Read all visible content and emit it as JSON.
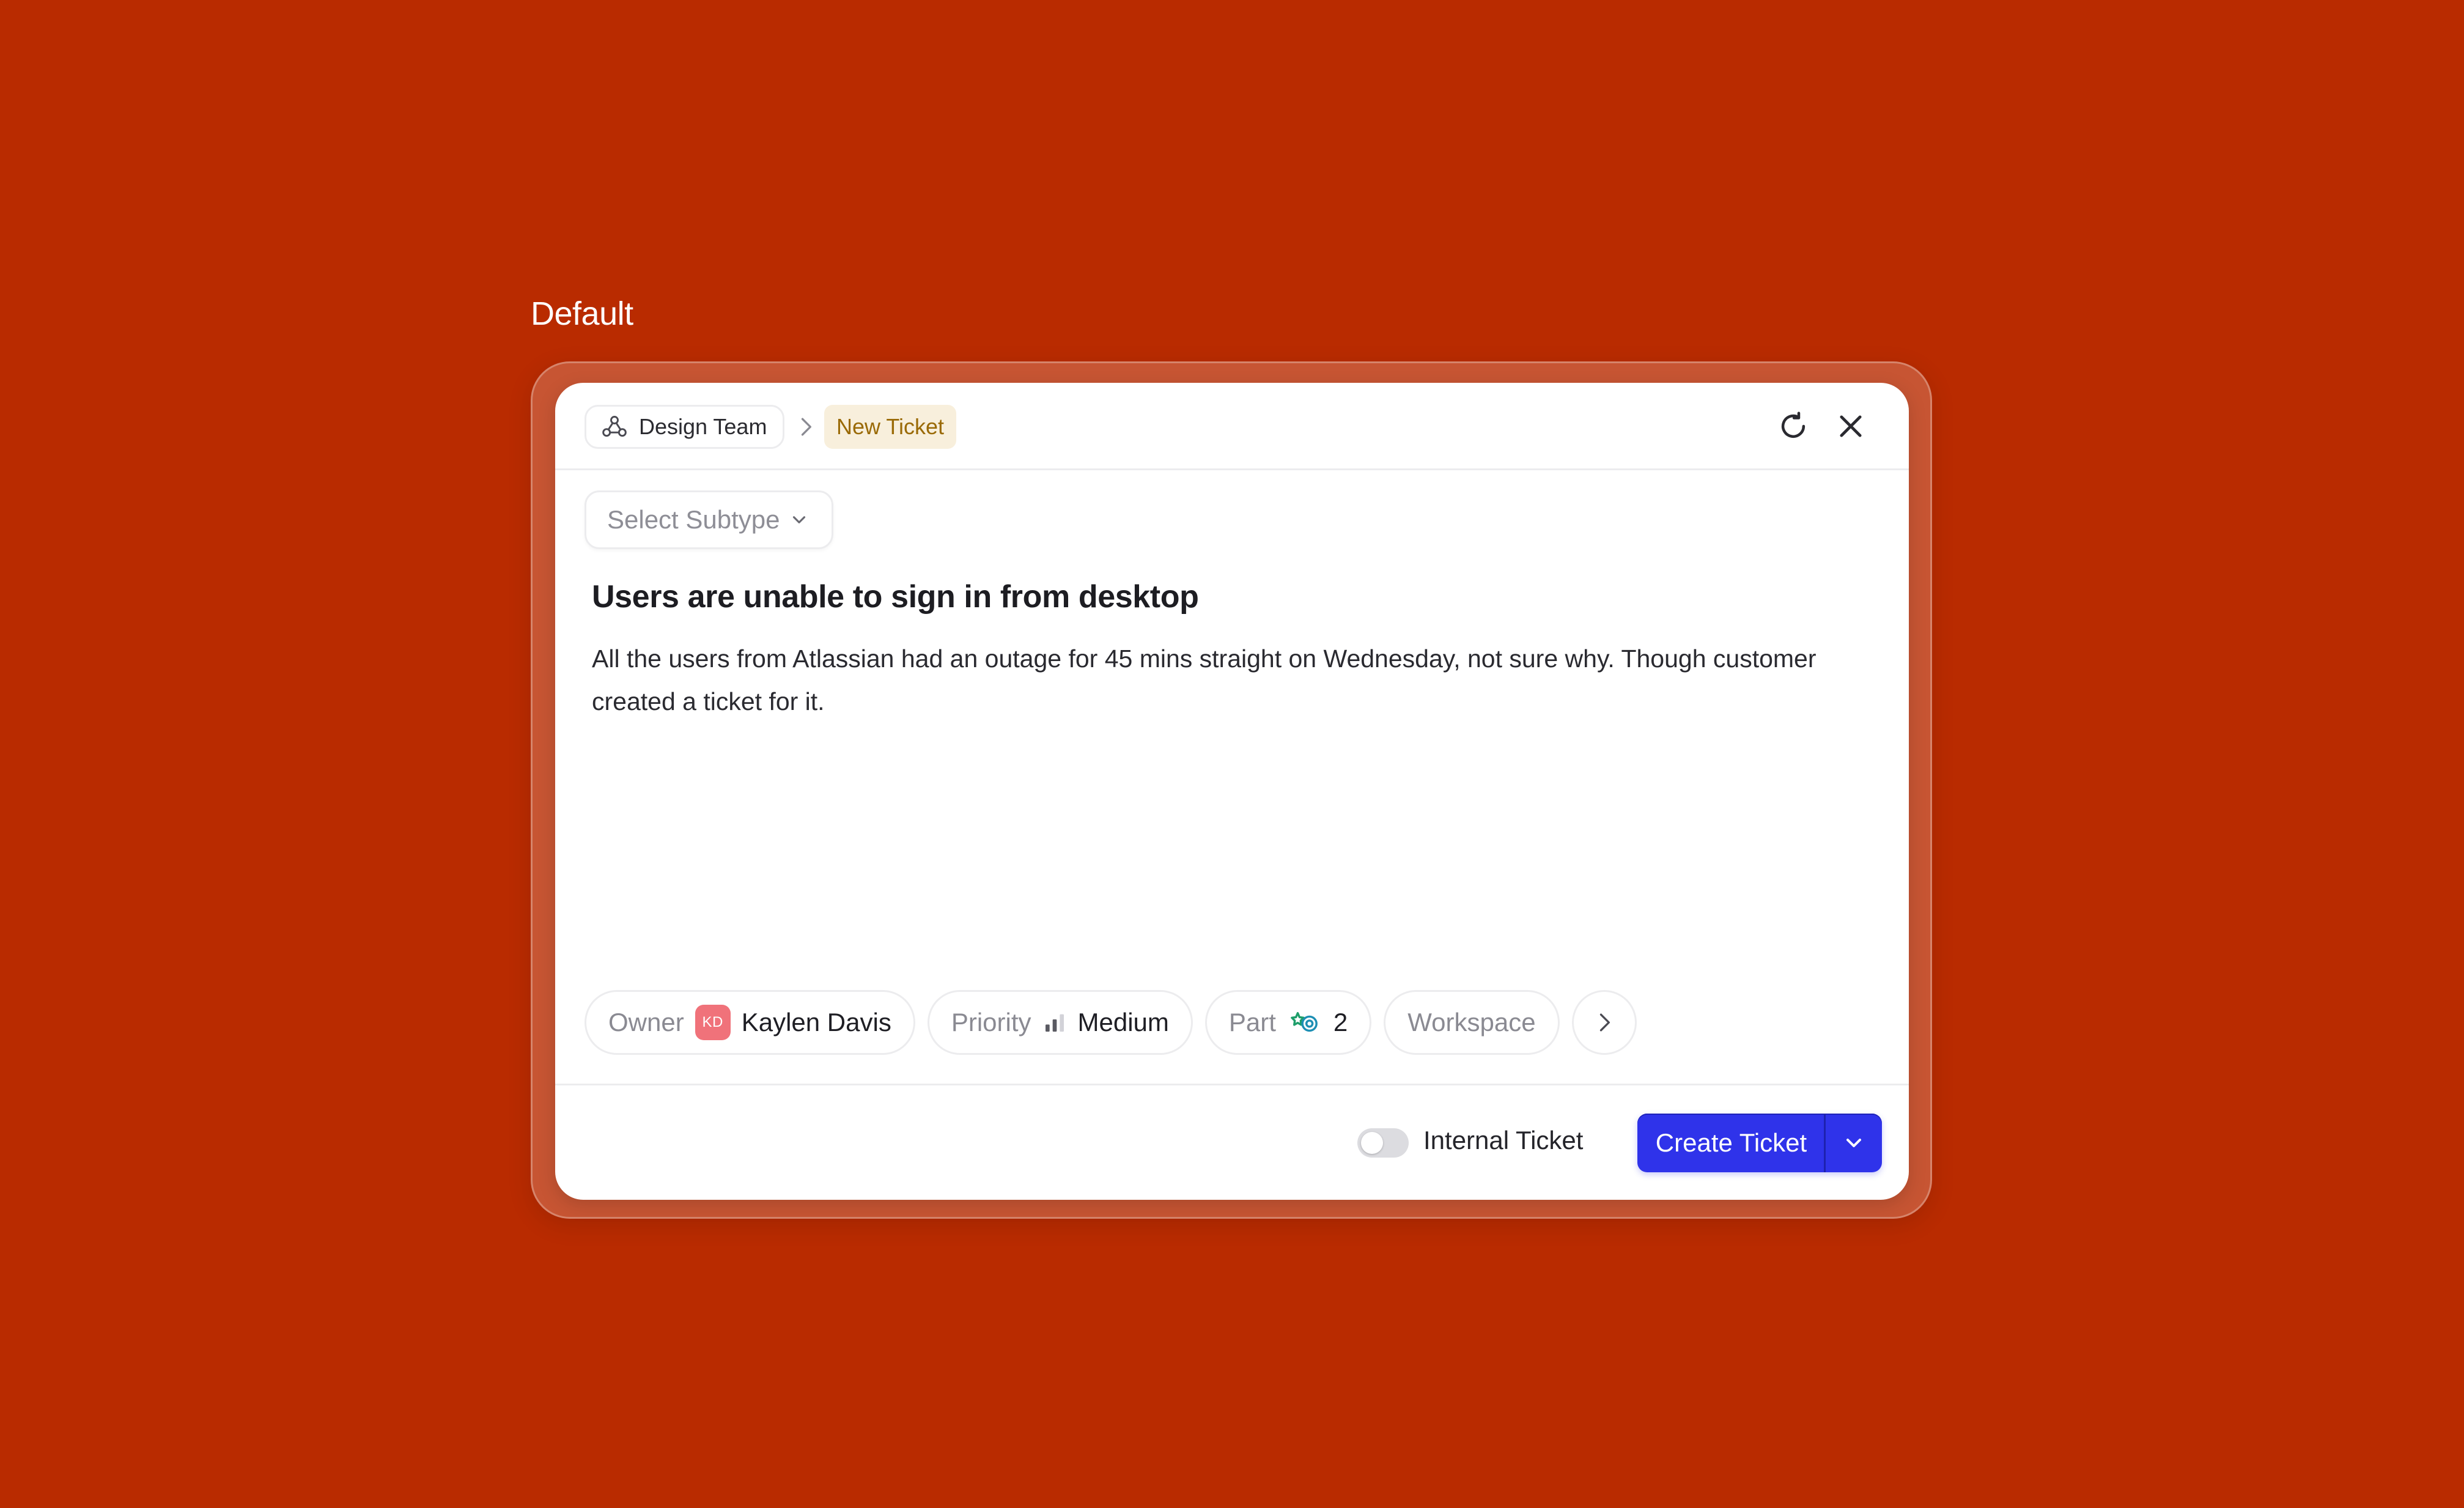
{
  "variant_label": "Default",
  "header": {
    "team_label": "Design Team",
    "new_ticket_label": "New Ticket"
  },
  "subtype": {
    "placeholder": "Select Subtype"
  },
  "ticket": {
    "title": "Users are unable to sign in from desktop",
    "description": "All the users from Atlassian had an outage for 45 mins straight on Wednesday, not sure why. Though customer created a ticket for it."
  },
  "chips": {
    "owner": {
      "label": "Owner",
      "initials": "KD",
      "value": "Kaylen Davis"
    },
    "priority": {
      "label": "Priority",
      "value": "Medium"
    },
    "part": {
      "label": "Part",
      "value": "2"
    },
    "workspace": {
      "label": "Workspace"
    }
  },
  "footer": {
    "toggle_label": "Internal Ticket",
    "toggle_on": false,
    "create_label": "Create Ticket"
  },
  "colors": {
    "background": "#b92b00",
    "primary": "#2f33ea",
    "new_ticket_text": "#9a6a06",
    "new_ticket_bg": "#f8efdc",
    "avatar": "#f0727a"
  }
}
